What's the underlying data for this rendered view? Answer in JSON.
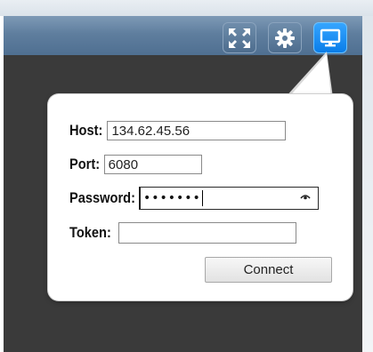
{
  "toolbar": {
    "buttons": [
      {
        "icon": "fullscreen-icon",
        "active": false
      },
      {
        "icon": "gear-icon",
        "active": false
      },
      {
        "icon": "monitor-icon",
        "active": true
      }
    ],
    "accent_color": "#1a8cf5"
  },
  "connect_panel": {
    "host": {
      "label": "Host:",
      "value": "134.62.45.56"
    },
    "port": {
      "label": "Port:",
      "value": "6080"
    },
    "password": {
      "label": "Password:",
      "masked_value": "•••••••"
    },
    "token": {
      "label": "Token:",
      "value": ""
    },
    "connect_label": "Connect"
  }
}
